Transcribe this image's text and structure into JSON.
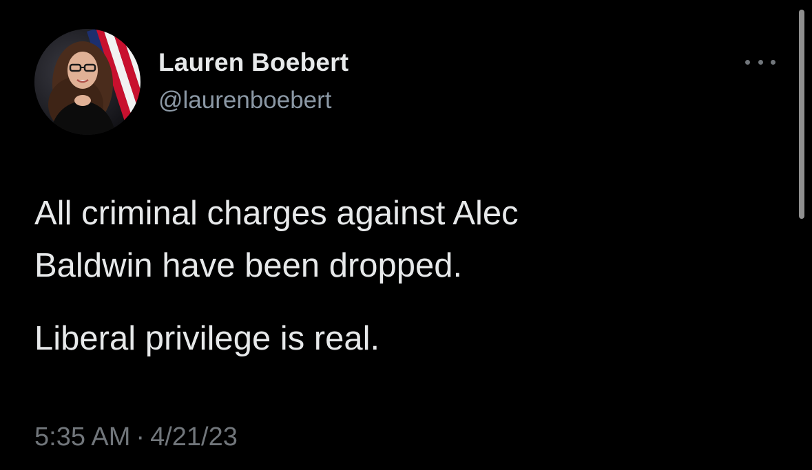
{
  "tweet": {
    "author": {
      "name": "Lauren Boebert",
      "handle": "@laurenboebert"
    },
    "text": {
      "line1": "All criminal charges against Alec",
      "line2": "Baldwin have been dropped.",
      "line3": "Liberal privilege is real."
    },
    "meta": {
      "time": "5:35 AM",
      "separator": "·",
      "date": "4/21/23"
    },
    "more_icon": "more-horizontal-icon"
  },
  "colors": {
    "background": "#000000",
    "primary_text": "#e7e9ea",
    "secondary_text": "#71767b",
    "handle_text": "#8b98a5"
  }
}
